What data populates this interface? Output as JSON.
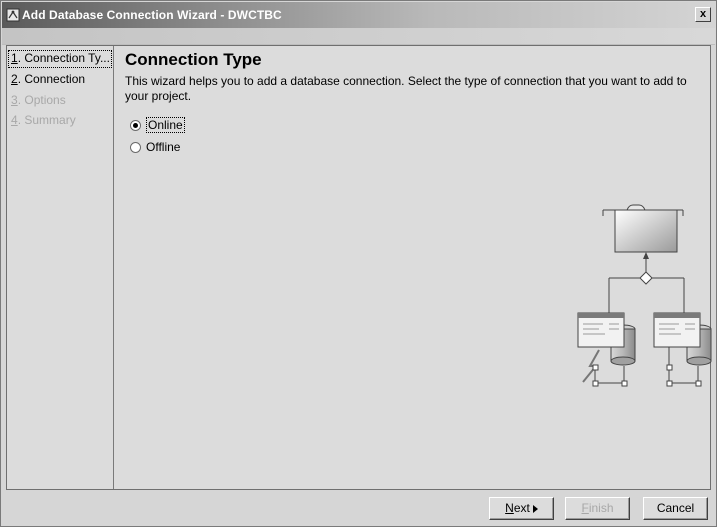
{
  "window": {
    "title": "Add Database Connection Wizard - DWCTBC",
    "close_label": "x"
  },
  "nav": {
    "items": [
      {
        "num": "1",
        "label": ". Connection Ty...",
        "state": "active"
      },
      {
        "num": "2",
        "label": ". Connection",
        "state": "enabled"
      },
      {
        "num": "3",
        "label": ". Options",
        "state": "disabled"
      },
      {
        "num": "4",
        "label": ". Summary",
        "state": "disabled"
      }
    ]
  },
  "main": {
    "title": "Connection Type",
    "description": "This wizard helps you to add a database connection. Select the type of connection that you want to add to your project.",
    "options": [
      {
        "label": "Online",
        "checked": true
      },
      {
        "label": "Offline",
        "checked": false
      }
    ]
  },
  "footer": {
    "next": {
      "mnemonic": "N",
      "rest": "ext"
    },
    "finish": {
      "mnemonic": "F",
      "rest": "inish"
    },
    "cancel": "Cancel"
  },
  "icons": {
    "app": "wizard-app-icon",
    "next_arrow": "triangle-right-icon",
    "illustration": "database-connection-illustration"
  }
}
